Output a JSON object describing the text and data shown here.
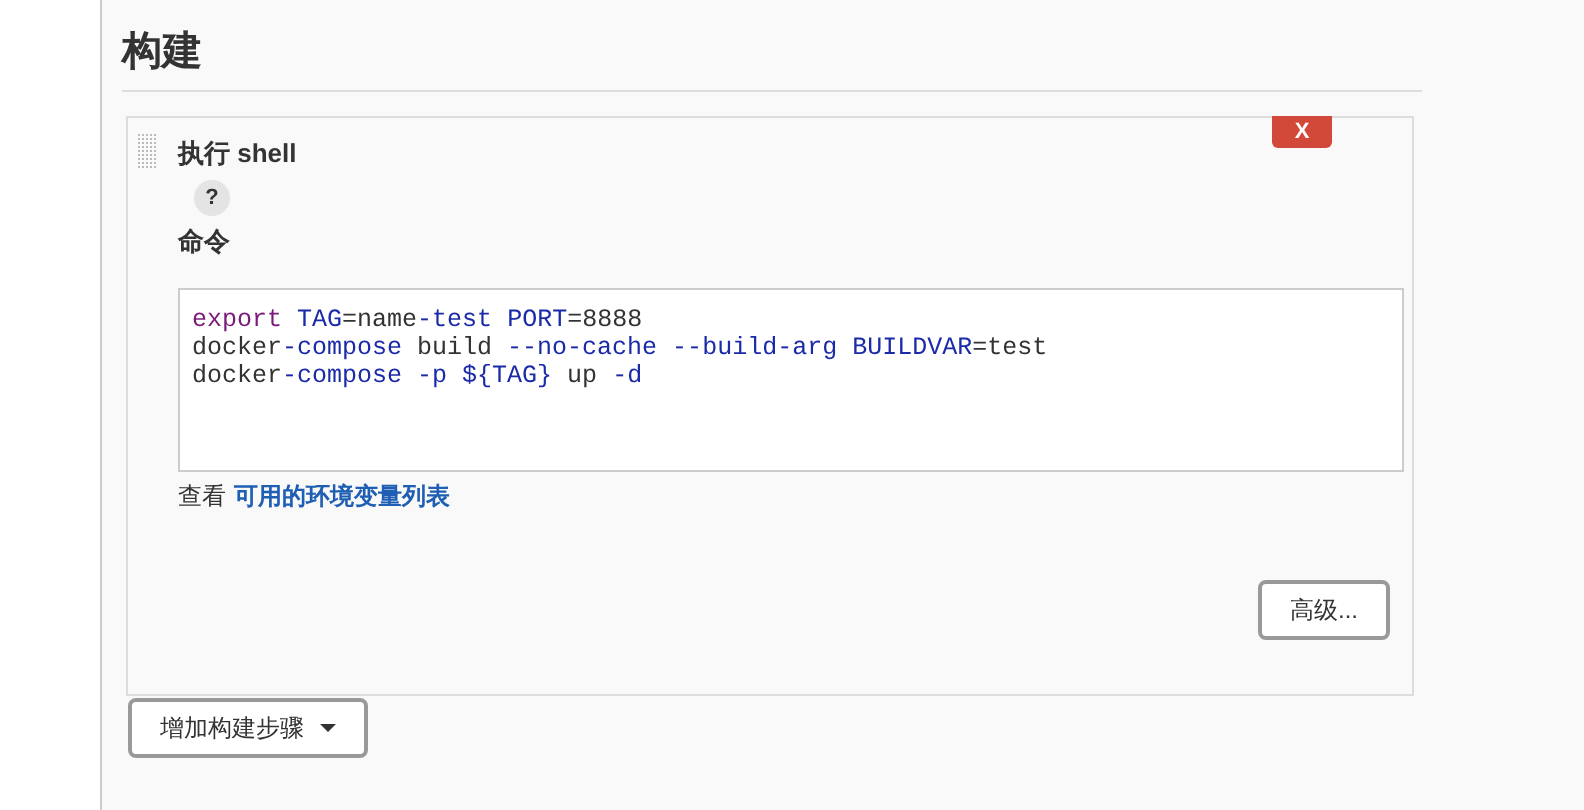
{
  "section": {
    "title": "构建"
  },
  "step": {
    "delete_label": "X",
    "title": "执行 shell",
    "help": "?",
    "field_label": "命令",
    "code_lines": [
      [
        {
          "text": "export",
          "kind": "keyword"
        },
        {
          "text": " TAG",
          "kind": "name"
        },
        {
          "text": "=name",
          "kind": "plain"
        },
        {
          "text": "-test",
          "kind": "name"
        },
        {
          "text": " PORT",
          "kind": "name"
        },
        {
          "text": "=8888",
          "kind": "plain"
        }
      ],
      [
        {
          "text": "docker",
          "kind": "plain"
        },
        {
          "text": "-compose",
          "kind": "name"
        },
        {
          "text": " build ",
          "kind": "plain"
        },
        {
          "text": "--no-cache --build-arg BUILDVAR",
          "kind": "name"
        },
        {
          "text": "=test",
          "kind": "plain"
        }
      ],
      [
        {
          "text": "docker",
          "kind": "plain"
        },
        {
          "text": "-compose -p ${TAG}",
          "kind": "name"
        },
        {
          "text": " up ",
          "kind": "plain"
        },
        {
          "text": "-d",
          "kind": "name"
        }
      ]
    ],
    "env_prefix": "查看",
    "env_link": "可用的环境变量列表",
    "advanced_button": "高级..."
  },
  "add_step_button": "增加构建步骤"
}
